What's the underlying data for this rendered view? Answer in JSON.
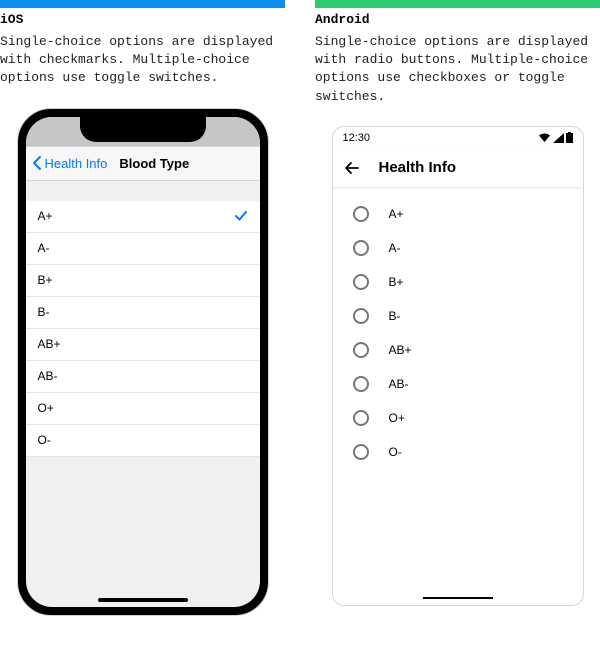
{
  "ios": {
    "header_label": "iOS",
    "description": "Single-choice options are displayed with checkmarks. Multiple-choice options use toggle switches.",
    "back_label": "Health Info",
    "title": "Blood Type",
    "rows": [
      {
        "label": "A+",
        "selected": true
      },
      {
        "label": "A-",
        "selected": false
      },
      {
        "label": "B+",
        "selected": false
      },
      {
        "label": "B-",
        "selected": false
      },
      {
        "label": "AB+",
        "selected": false
      },
      {
        "label": "AB-",
        "selected": false
      },
      {
        "label": "O+",
        "selected": false
      },
      {
        "label": "O-",
        "selected": false
      }
    ]
  },
  "android": {
    "header_label": "Android",
    "description": "Single-choice options are displayed with radio buttons. Multiple-choice options use checkboxes or toggle switches.",
    "status_time": "12:30",
    "title": "Health Info",
    "rows": [
      {
        "label": "A+",
        "selected": false
      },
      {
        "label": "A-",
        "selected": false
      },
      {
        "label": "B+",
        "selected": false
      },
      {
        "label": "B-",
        "selected": false
      },
      {
        "label": "AB+",
        "selected": false
      },
      {
        "label": "AB-",
        "selected": false
      },
      {
        "label": "O+",
        "selected": false
      },
      {
        "label": "O-",
        "selected": false
      }
    ]
  }
}
